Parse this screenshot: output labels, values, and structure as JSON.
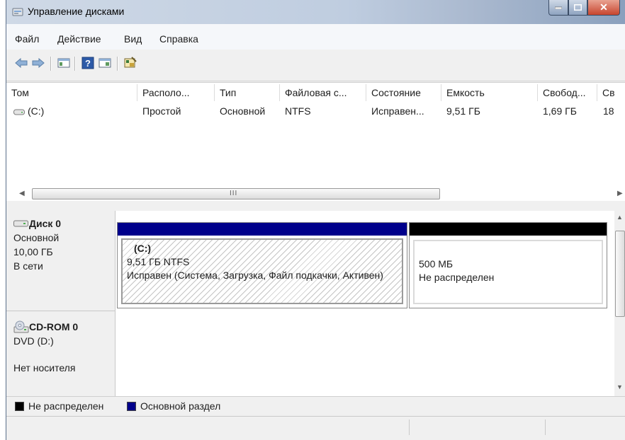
{
  "window": {
    "title": "Управление дисками"
  },
  "menu": [
    "Файл",
    "Действие",
    "Вид",
    "Справка"
  ],
  "toolbar": {
    "buttons": [
      "back",
      "forward",
      "console-tree",
      "help",
      "properties-view",
      "settings"
    ]
  },
  "volumes": {
    "columns": [
      "Том",
      "Располо...",
      "Тип",
      "Файловая с...",
      "Состояние",
      "Емкость",
      "Свобод...",
      "Св"
    ],
    "rows": [
      {
        "volume": "(C:)",
        "layout": "Простой",
        "type": "Основной",
        "fs": "NTFS",
        "status": "Исправен...",
        "capacity": "9,51 ГБ",
        "free": "1,69 ГБ",
        "free_pct": "18"
      }
    ],
    "scroll_grip": "III"
  },
  "disks": [
    {
      "name": "Диск 0",
      "type": "Основной",
      "size": "10,00 ГБ",
      "state": "В сети",
      "partitions": [
        {
          "title": "(C:)",
          "size": "9,51 ГБ NTFS",
          "status": "Исправен (Система, Загрузка, Файл подкачки, Активен)",
          "bar_color": "#00008b",
          "kind": "primary"
        },
        {
          "size": "500 МБ",
          "status": "Не распределен",
          "bar_color": "#000000",
          "kind": "unallocated"
        }
      ]
    },
    {
      "name": "CD-ROM 0",
      "type": "DVD (D:)",
      "state": "Нет носителя"
    }
  ],
  "legend": [
    {
      "label": "Не распределен",
      "color": "#000000"
    },
    {
      "label": "Основной раздел",
      "color": "#00008b"
    }
  ],
  "colors": {
    "unallocated": "#000000",
    "primary": "#00008b",
    "title_gradient_end": "#8aa0bd"
  }
}
